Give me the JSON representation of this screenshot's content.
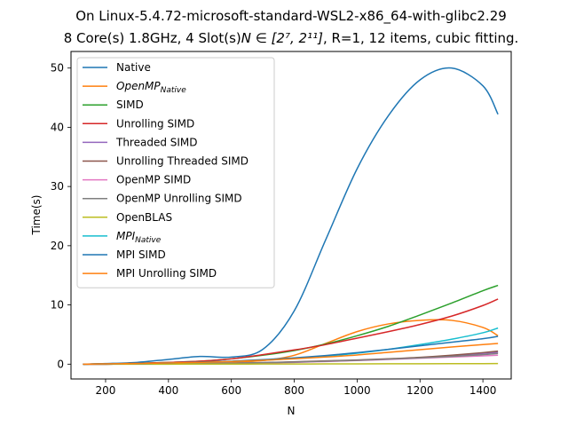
{
  "chart_data": {
    "type": "line",
    "title_line1": "On Linux-5.4.72-microsoft-standard-WSL2-x86_64-with-glibc2.29",
    "title_line2_prefix": "8 Core(s) 1.8GHz, 4 Slot(s)",
    "title_line2_math": "N ∈ [2⁷, 2¹¹]",
    "title_line2_suffix": ", R=1, 12 items, cubic fitting.",
    "xlabel": "N",
    "ylabel": "Time(s)",
    "xlim": [
      90,
      1490
    ],
    "ylim": [
      -2.5,
      52.8
    ],
    "xticks": [
      200,
      400,
      600,
      800,
      1000,
      1200,
      1400
    ],
    "yticks": [
      0,
      10,
      20,
      30,
      40,
      50
    ],
    "grid": false,
    "legend_position": "top-left",
    "x": [
      128,
      200,
      300,
      400,
      500,
      600,
      700,
      800,
      900,
      1000,
      1100,
      1200,
      1300,
      1400,
      1448
    ],
    "series": [
      {
        "name": "Native",
        "color": "#1f77b4",
        "values": [
          0,
          0.1,
          0.3,
          0.8,
          1.3,
          1.2,
          2.5,
          9.0,
          21.0,
          33.0,
          42.0,
          48.0,
          50.0,
          47.0,
          42.2
        ]
      },
      {
        "name": "OpenMP_Native",
        "name_base": "OpenMP",
        "name_sub": "Native",
        "color": "#ff7f0e",
        "values": [
          0,
          0,
          0.05,
          0.1,
          0.2,
          0.3,
          0.6,
          1.5,
          3.5,
          5.5,
          6.8,
          7.4,
          7.4,
          6.2,
          4.8
        ]
      },
      {
        "name": "SIMD",
        "color": "#2ca02c",
        "values": [
          0,
          0.05,
          0.15,
          0.3,
          0.5,
          0.9,
          1.5,
          2.3,
          3.4,
          4.8,
          6.4,
          8.3,
          10.3,
          12.4,
          13.3
        ]
      },
      {
        "name": "Unrolling SIMD",
        "color": "#d62728",
        "values": [
          0,
          0.05,
          0.15,
          0.3,
          0.5,
          0.9,
          1.6,
          2.4,
          3.3,
          4.4,
          5.5,
          6.7,
          8.1,
          9.9,
          11.0
        ]
      },
      {
        "name": "Threaded SIMD",
        "color": "#9467bd",
        "values": [
          0,
          0,
          0.02,
          0.05,
          0.1,
          0.15,
          0.25,
          0.35,
          0.5,
          0.65,
          0.85,
          1.1,
          1.4,
          1.8,
          2.0
        ]
      },
      {
        "name": "Unrolling Threaded SIMD",
        "color": "#8c564b",
        "values": [
          0,
          0,
          0.02,
          0.05,
          0.1,
          0.15,
          0.25,
          0.4,
          0.55,
          0.7,
          0.9,
          1.15,
          1.5,
          1.95,
          2.2
        ]
      },
      {
        "name": "OpenMP SIMD",
        "color": "#e377c2",
        "values": [
          0,
          0,
          0.02,
          0.05,
          0.1,
          0.15,
          0.2,
          0.3,
          0.45,
          0.6,
          0.8,
          1.0,
          1.2,
          1.4,
          1.5
        ]
      },
      {
        "name": "OpenMP Unrolling SIMD",
        "color": "#7f7f7f",
        "values": [
          0,
          0,
          0.02,
          0.05,
          0.1,
          0.15,
          0.25,
          0.35,
          0.5,
          0.65,
          0.85,
          1.05,
          1.3,
          1.6,
          1.8
        ]
      },
      {
        "name": "OpenBLAS",
        "color": "#bcbd22",
        "values": [
          0,
          0,
          0,
          0,
          0.01,
          0.01,
          0.02,
          0.03,
          0.04,
          0.05,
          0.06,
          0.07,
          0.08,
          0.09,
          0.1
        ]
      },
      {
        "name": "MPI_Native",
        "name_base": "MPI",
        "name_sub": "Native",
        "color": "#17becf",
        "values": [
          0,
          0.05,
          0.1,
          0.2,
          0.3,
          0.45,
          0.65,
          0.95,
          1.35,
          1.85,
          2.5,
          3.3,
          4.2,
          5.3,
          6.1
        ]
      },
      {
        "name": "MPI SIMD",
        "color": "#1f77b4",
        "values": [
          0,
          0.05,
          0.1,
          0.2,
          0.35,
          0.5,
          0.75,
          1.05,
          1.45,
          1.95,
          2.5,
          3.1,
          3.7,
          4.3,
          4.7
        ]
      },
      {
        "name": "MPI Unrolling SIMD",
        "color": "#ff7f0e",
        "values": [
          0,
          0.05,
          0.1,
          0.2,
          0.3,
          0.45,
          0.65,
          0.9,
          1.2,
          1.55,
          2.0,
          2.45,
          2.9,
          3.3,
          3.5
        ]
      }
    ]
  }
}
